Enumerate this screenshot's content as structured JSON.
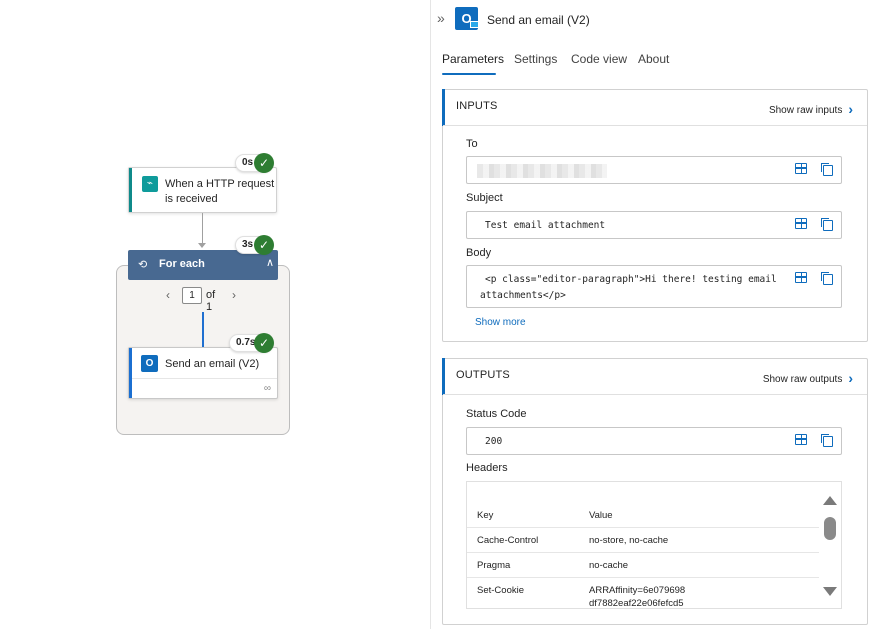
{
  "canvas": {
    "trigger": {
      "title": "When a HTTP request is received",
      "duration": "0s"
    },
    "foreach": {
      "title": "For each",
      "duration": "3s",
      "page_current": "1",
      "page_total": "of 1"
    },
    "action": {
      "title": "Send an email (V2)",
      "duration": "0.7s"
    }
  },
  "panel": {
    "title": "Send an email (V2)",
    "tabs": [
      {
        "label": "Parameters"
      },
      {
        "label": "Settings"
      },
      {
        "label": "Code view"
      },
      {
        "label": "About"
      }
    ],
    "inputs": {
      "title": "INPUTS",
      "raw_label": "Show raw inputs",
      "to_label": "To",
      "to_value": "",
      "subject_label": "Subject",
      "subject_value": "Test email attachment",
      "body_label": "Body",
      "body_line1": "<p class=\"editor-paragraph\">Hi there! testing email",
      "body_line2": "attachments</p>",
      "show_more": "Show more"
    },
    "outputs": {
      "title": "OUTPUTS",
      "raw_label": "Show raw outputs",
      "status_label": "Status Code",
      "status_value": "200",
      "headers_label": "Headers",
      "headers_columns": {
        "key": "Key",
        "value": "Value"
      },
      "headers_rows": [
        {
          "key": "Cache-Control",
          "value": "no-store, no-cache"
        },
        {
          "key": "Pragma",
          "value": "no-cache"
        },
        {
          "key": "Set-Cookie",
          "value": "ARRAffinity=6e079698",
          "value2": "df7882eaf22e06fefcd5"
        }
      ]
    }
  },
  "colors": {
    "accent": "#0f6cbd",
    "success": "#2e7d32",
    "foreach_header": "#486991",
    "trigger_accent": "#0f8a8a"
  }
}
